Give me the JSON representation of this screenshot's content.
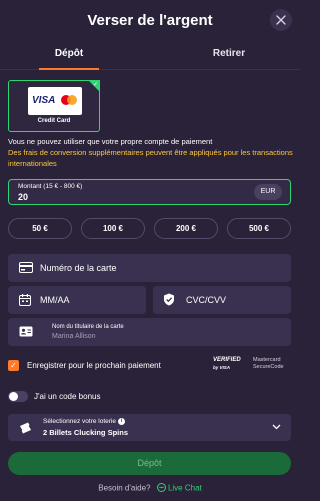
{
  "header": {
    "title": "Verser de l'argent",
    "close_icon": "close-icon"
  },
  "tabs": [
    {
      "label": "Dépôt",
      "active": true
    },
    {
      "label": "Retirer",
      "active": false
    }
  ],
  "payment_method": {
    "label": "Credit Card",
    "logo_visa": "VISA",
    "selected": true
  },
  "info": {
    "own_account": "Vous ne pouvez utiliser que votre propre compte de paiement",
    "conversion_fees": "Des frais de conversion supplémentaires peuvent être appliqués pour les transactions internationales"
  },
  "amount": {
    "label": "Montant (15 € - 800 €)",
    "value": "20",
    "currency": "EUR"
  },
  "presets": [
    "50 €",
    "100 €",
    "200 €",
    "500 €"
  ],
  "card_form": {
    "card_number_placeholder": "Numéro de la carte",
    "expiry_placeholder": "MM/AA",
    "cvc_placeholder": "CVC/CVV",
    "holder_label": "Nom du titulaire de la carte",
    "holder_value": "Marina Allison"
  },
  "save": {
    "label": "Enregistrer pour le prochain paiement",
    "checked": true
  },
  "badges": {
    "verified_by_visa_line1": "VERIFIED",
    "verified_by_visa_line2": "by VISA",
    "mastercard_line1": "Mastercard",
    "mastercard_line2": "SecureCode"
  },
  "bonus": {
    "label": "J'ai un code bonus",
    "enabled": false
  },
  "lottery": {
    "label": "Sélectionnez votre loterie",
    "value": "2 Billets Clucking Spins"
  },
  "submit": {
    "label": "Dépôt"
  },
  "help": {
    "text": "Besoin d'aide?",
    "link": "Live Chat"
  },
  "colors": {
    "background": "#2a2238",
    "accent_green": "#2ed573",
    "accent_orange": "#ff7a2a",
    "warning_yellow": "#ffc83d",
    "field_bg": "#3a3150"
  }
}
